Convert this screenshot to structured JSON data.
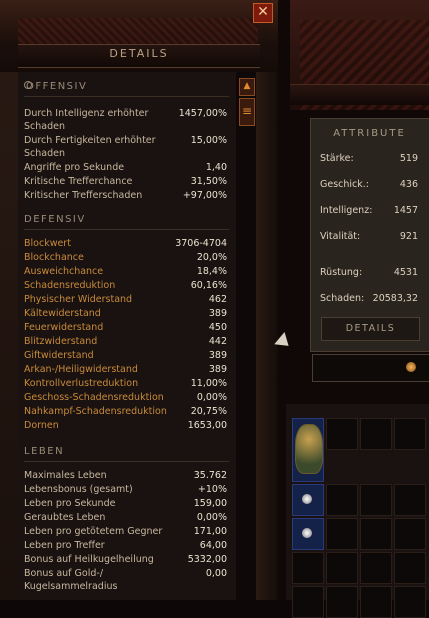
{
  "panel": {
    "title": "DETAILS",
    "close_icon": "close-icon"
  },
  "offensiv": {
    "heading": "OFFENSIV",
    "stats": [
      {
        "label": "Durch Intelligenz erhöhter Schaden",
        "value": "1457,00%"
      },
      {
        "label": "Durch Fertigkeiten erhöhter Schaden",
        "value": "15,00%"
      },
      {
        "label": "Angriffe pro Sekunde",
        "value": "1,40"
      },
      {
        "label": "Kritische Trefferchance",
        "value": "31,50%"
      },
      {
        "label": "Kritischer Trefferschaden",
        "value": "+97,00%"
      }
    ]
  },
  "defensiv": {
    "heading": "DEFENSIV",
    "stats": [
      {
        "label": "Blockwert",
        "value": "3706-4704"
      },
      {
        "label": "Blockchance",
        "value": "20,0%"
      },
      {
        "label": "Ausweichchance",
        "value": "18,4%"
      },
      {
        "label": "Schadensreduktion",
        "value": "60,16%"
      },
      {
        "label": "Physischer Widerstand",
        "value": "462"
      },
      {
        "label": "Kältewiderstand",
        "value": "389"
      },
      {
        "label": "Feuerwiderstand",
        "value": "450"
      },
      {
        "label": "Blitzwiderstand",
        "value": "442"
      },
      {
        "label": "Giftwiderstand",
        "value": "389"
      },
      {
        "label": "Arkan-/Heiligwiderstand",
        "value": "389"
      },
      {
        "label": "Kontrollverlustreduktion",
        "value": "11,00%"
      },
      {
        "label": "Geschoss-Schadensreduktion",
        "value": "0,00%"
      },
      {
        "label": "Nahkampf-Schadensreduktion",
        "value": "20,75%"
      },
      {
        "label": "Dornen",
        "value": "1653,00"
      }
    ]
  },
  "leben": {
    "heading": "LEBEN",
    "stats": [
      {
        "label": "Maximales Leben",
        "value": "35.762"
      },
      {
        "label": "Lebensbonus (gesamt)",
        "value": "+10%"
      },
      {
        "label": "Leben pro Sekunde",
        "value": "159,00"
      },
      {
        "label": "Geraubtes Leben",
        "value": "0,00%"
      },
      {
        "label": "Leben pro getötetem Gegner",
        "value": "171,00"
      },
      {
        "label": "Leben pro Treffer",
        "value": "64,00"
      },
      {
        "label": "Bonus auf Heilkugelheilung",
        "value": "5332,00"
      },
      {
        "label": "Bonus auf Gold-/ Kugelsammelradius",
        "value": "0,00"
      }
    ]
  },
  "attribute": {
    "title": "ATTRIBUTE",
    "rows": [
      {
        "label": "Stärke:",
        "value": "519"
      },
      {
        "label": "Geschick.:",
        "value": "436"
      },
      {
        "label": "Intelligenz:",
        "value": "1457"
      },
      {
        "label": "Vitalität:",
        "value": "921"
      },
      {
        "label": "Rüstung:",
        "value": "4531"
      },
      {
        "label": "Schaden:",
        "value": "20583,32"
      }
    ],
    "details_button": "DETAILS"
  },
  "colors": {
    "accent": "#c98a3a",
    "close": "#7d1a0c"
  }
}
